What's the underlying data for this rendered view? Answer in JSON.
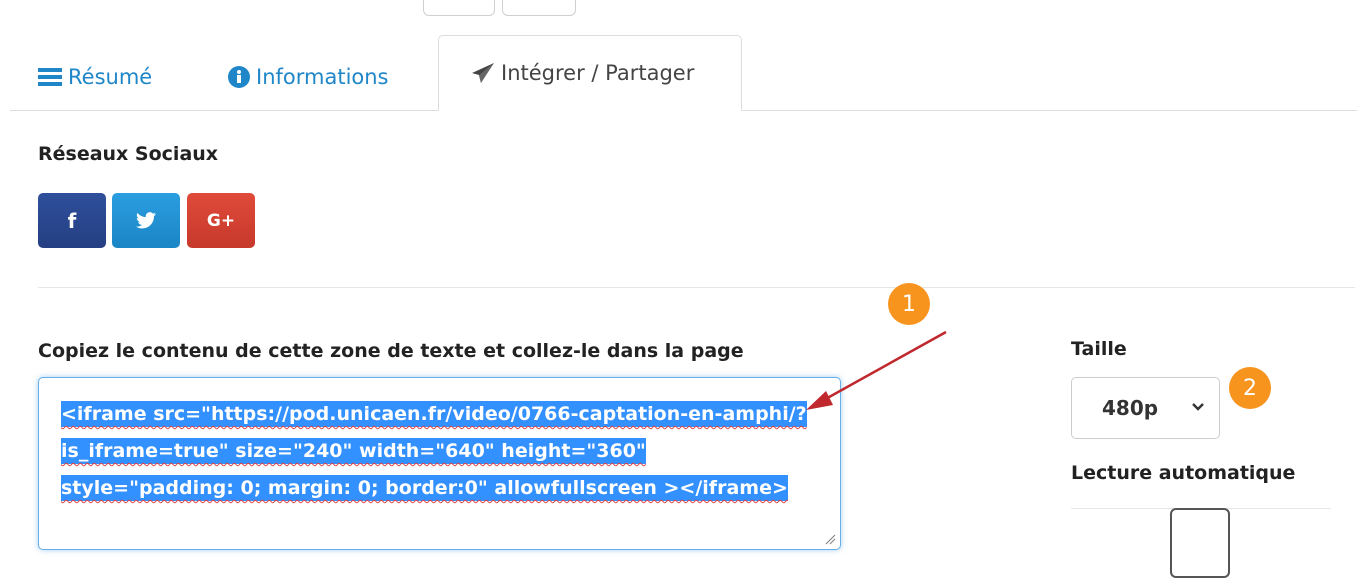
{
  "tabs": {
    "resume": "Résumé",
    "informations": "Informations",
    "share": "Intégrer / Partager"
  },
  "social": {
    "title": "Réseaux Sociaux",
    "facebook_label": "f",
    "google_label": "G+"
  },
  "embed": {
    "label": "Copiez le contenu de cette zone de texte et collez-le dans la page",
    "code": "<iframe src=\"https://pod.unicaen.fr/video/0766-captation-en-amphi/?is_iframe=true\" size=\"240\" width=\"640\" height=\"360\" style=\"padding: 0; margin: 0; border:0\" allowfullscreen ></iframe>"
  },
  "options": {
    "size_label": "Taille",
    "size_value": "480p",
    "autoplay_label": "Lecture automatique"
  },
  "annotations": {
    "badge1": "1",
    "badge2": "2"
  },
  "colors": {
    "link": "#1f86c8",
    "facebook": "#2f4f9c",
    "twitter": "#2a9ee0",
    "google": "#e04a3a",
    "selection": "#3390ff",
    "badge": "#f7941d",
    "arrow": "#c0282d"
  }
}
